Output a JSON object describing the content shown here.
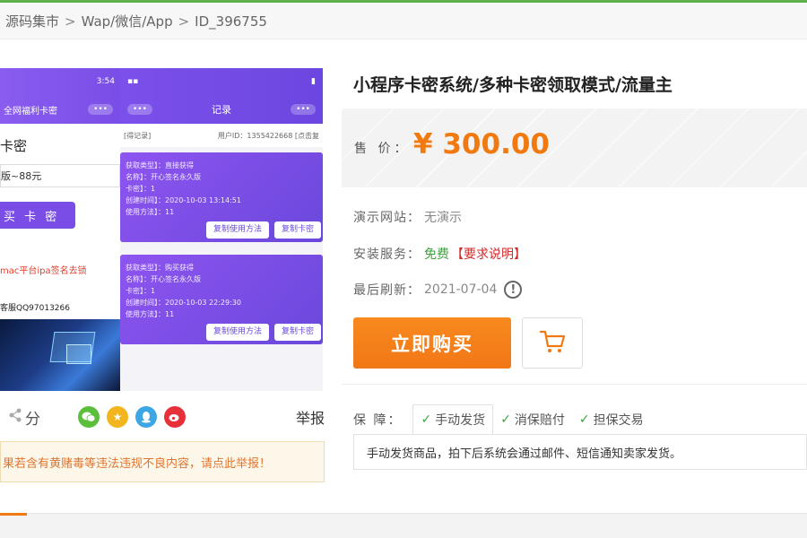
{
  "breadcrumb": {
    "items": [
      "源码集市",
      "Wap/微信/App",
      "ID_396755"
    ],
    "sep": ">"
  },
  "gallery": {
    "left_phone": {
      "time": "3:54",
      "nav_title": "全网福利卡密",
      "dots": "•••",
      "heading": "卡密",
      "select_value": "版~88元",
      "buy_button": "买 卡 密",
      "red_notice": "mac平台ipa签名去锁",
      "contact": "客服QQ97013266"
    },
    "right_phone": {
      "nav_title": "记录",
      "dots": "•••",
      "head_left": "[得记录]",
      "head_right": "用户ID：1355422668 [点击复",
      "cards": [
        {
          "lines": [
            "获取类型】：直接获得",
            "名称】：开心签名永久版",
            "卡密】：1",
            "创建时间】：2020-10-03 13:14:51",
            "使用方法】：11"
          ],
          "btn1": "复制使用方法",
          "btn2": "复制卡密"
        },
        {
          "lines": [
            "获取类型】：购买获得",
            "名称】：开心签名永久版",
            "卡密】：1",
            "创建时间】：2020-10-03 22:29:30",
            "使用方法】：11"
          ],
          "btn1": "复制使用方法",
          "btn2": "复制卡密"
        }
      ]
    }
  },
  "share": {
    "label": "分",
    "report": "举报",
    "icons": [
      "wechat-icon",
      "qzone-icon",
      "qq-icon",
      "weibo-icon"
    ]
  },
  "warning": "果若含有黄赌毒等违法违规不良内容，请点此举报！",
  "product": {
    "title": "小程序卡密系统/多种卡密领取模式/流量主",
    "price_label": "售 价：",
    "price": "¥ 300.00",
    "demo_label": "演示网站：",
    "demo_value": "无演示",
    "install_label": "安装服务：",
    "install_free": "免费",
    "install_req": "【要求说明】",
    "refresh_label": "最后刷新：",
    "refresh_value": "2021-07-04",
    "buy_button": "立即购买"
  },
  "guarantee": {
    "label": "保 障：",
    "tabs": [
      "手动发货",
      "消保赔付",
      "担保交易"
    ],
    "desc": "手动发货商品，拍下后系统会通过邮件、短信通知卖家发货。"
  },
  "colors": {
    "accent": "#f07a10",
    "purple": "#7a4ee6",
    "green": "#3aa33a",
    "red": "#d12a2a"
  }
}
